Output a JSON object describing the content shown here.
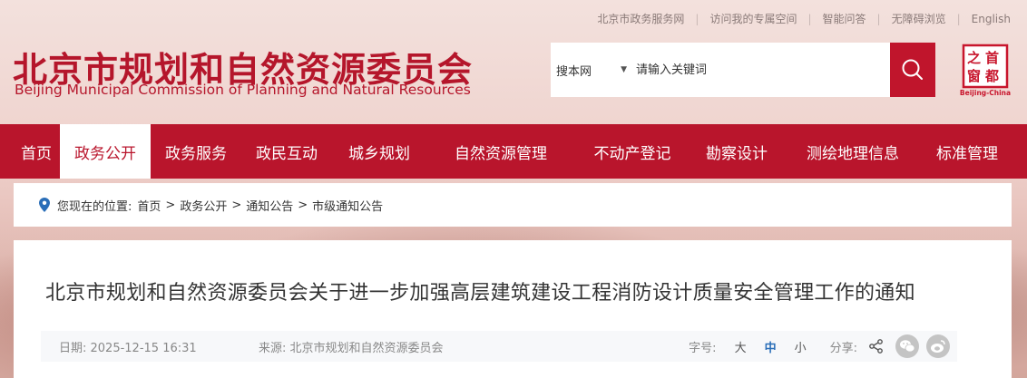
{
  "top_links": [
    "北京市政务服务网",
    "访问我的专属空间",
    "智能问答",
    "无障碍浏览",
    "English"
  ],
  "logo": {
    "title_cn": "北京市规划和自然资源委员会",
    "title_en": "Beijing Municipal Commission of Planning and Natural Resources"
  },
  "search": {
    "scope": "搜本网",
    "placeholder": "请输入关键词"
  },
  "seal": {
    "chars": [
      "首",
      "都",
      "之",
      "窗"
    ],
    "caption": "Beijing-China"
  },
  "nav": {
    "items": [
      "首页",
      "政务公开",
      "政务服务",
      "政民互动",
      "城乡规划",
      "自然资源管理",
      "不动产登记",
      "勘察设计",
      "测绘地理信息",
      "标准管理"
    ],
    "active_index": 1
  },
  "breadcrumb": {
    "prefix": "您现在的位置:",
    "items": [
      "首页",
      "政务公开",
      "通知公告",
      "市级通知公告"
    ]
  },
  "article": {
    "title": "北京市规划和自然资源委员会关于进一步加强高层建筑建设工程消防设计质量安全管理工作的通知",
    "date": "日期: 2025-12-15 16:31",
    "source": "来源: 北京市规划和自然资源委员会",
    "font_size_label": "字号:",
    "font_sizes": [
      "大",
      "中",
      "小"
    ],
    "active_font_size": "中",
    "share_label": "分享:"
  },
  "colors": {
    "brand_red": "#b9152c",
    "link_blue": "#2a6eb8"
  }
}
